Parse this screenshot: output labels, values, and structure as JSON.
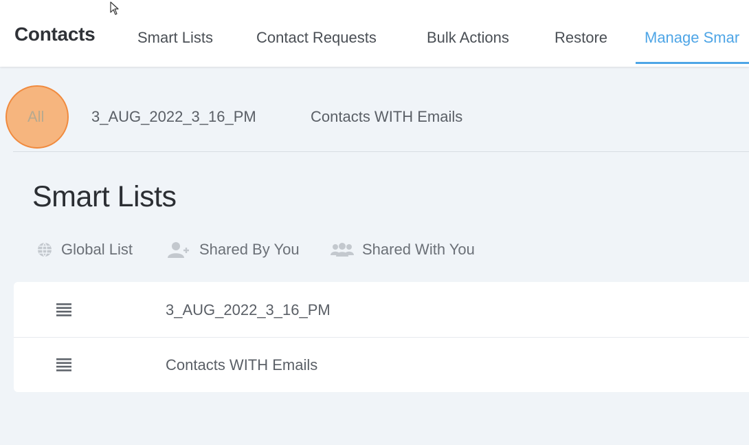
{
  "header": {
    "app_title": "Contacts",
    "tabs": [
      {
        "label": "Smart Lists"
      },
      {
        "label": "Contact Requests"
      },
      {
        "label": "Bulk Actions"
      },
      {
        "label": "Restore"
      },
      {
        "label": "Manage Smar",
        "active": true
      }
    ]
  },
  "filters": {
    "tabs": [
      {
        "label": "All",
        "highlighted": true
      },
      {
        "label": "3_AUG_2022_3_16_PM"
      },
      {
        "label": "Contacts WITH Emails"
      }
    ]
  },
  "main": {
    "title": "Smart Lists",
    "legend": [
      {
        "icon": "globe-icon",
        "label": "Global List"
      },
      {
        "icon": "user-plus-icon",
        "label": "Shared By You"
      },
      {
        "icon": "users-icon",
        "label": "Shared With You"
      }
    ],
    "lists": [
      {
        "icon": "list-icon",
        "name": "3_AUG_2022_3_16_PM"
      },
      {
        "icon": "list-icon",
        "name": "Contacts WITH Emails"
      }
    ]
  },
  "colors": {
    "accent": "#4ea5e6",
    "highlight": "#f7a969",
    "background": "#f0f4f8"
  }
}
